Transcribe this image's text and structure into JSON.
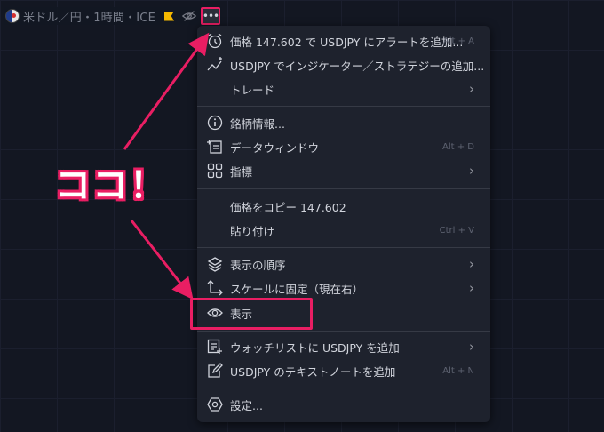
{
  "header": {
    "symbol_label": "米ドル／円・1時間・ICE",
    "more_label": "•••"
  },
  "menu": {
    "items": [
      {
        "label": "価格 147.602 で USDJPY にアラートを追加...",
        "shortcut": "Alt + A",
        "icon": "alarm-plus-icon"
      },
      {
        "label": "USDJPY でインジケーター／ストラテジーの追加...",
        "shortcut": "",
        "icon": "indicator-add-icon"
      },
      {
        "label": "トレード",
        "shortcut": "",
        "icon": "",
        "submenu": true
      },
      {
        "label": "銘柄情報...",
        "shortcut": "",
        "icon": "info-icon"
      },
      {
        "label": "データウィンドウ",
        "shortcut": "Alt + D",
        "icon": "data-window-icon"
      },
      {
        "label": "指標",
        "shortcut": "",
        "icon": "grid-icon",
        "submenu": true
      },
      {
        "label": "価格をコピー 147.602",
        "shortcut": "",
        "icon": ""
      },
      {
        "label": "貼り付け",
        "shortcut": "Ctrl + V",
        "icon": ""
      },
      {
        "label": "表示の順序",
        "shortcut": "",
        "icon": "layers-icon",
        "submenu": true
      },
      {
        "label": "スケールに固定（現在右）",
        "shortcut": "",
        "icon": "scale-pin-icon",
        "submenu": true
      },
      {
        "label": "表示",
        "shortcut": "",
        "icon": "eye-icon"
      },
      {
        "label": "ウォッチリストに USDJPY を追加",
        "shortcut": "",
        "icon": "watchlist-add-icon",
        "submenu": true
      },
      {
        "label": "USDJPY のテキストノートを追加",
        "shortcut": "Alt + N",
        "icon": "note-edit-icon"
      },
      {
        "label": "設定...",
        "shortcut": "",
        "icon": "settings-icon"
      }
    ],
    "chevron": "›"
  },
  "annotation": {
    "callout_text": "ココ！",
    "accent_color": "#e91e63"
  }
}
